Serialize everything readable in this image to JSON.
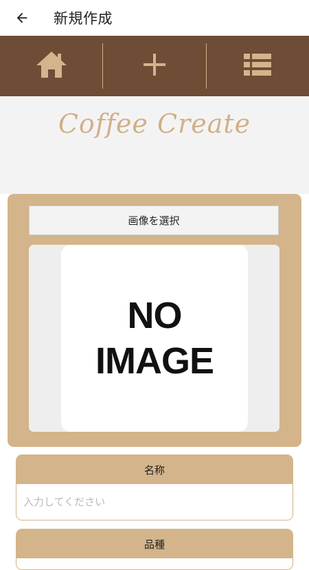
{
  "appbar": {
    "title": "新規作成"
  },
  "nav": {
    "items": [
      {
        "icon": "home-icon"
      },
      {
        "icon": "plus-icon"
      },
      {
        "icon": "list-icon"
      }
    ]
  },
  "brand": {
    "text": "Coffee Create"
  },
  "image_section": {
    "select_button_label": "画像を選択",
    "placeholder_line1": "NO",
    "placeholder_line2": "IMAGE"
  },
  "fields": {
    "name": {
      "label": "名称",
      "placeholder": "入力してください",
      "value": ""
    },
    "variety": {
      "label": "品種"
    }
  },
  "colors": {
    "nav_background": "#6e4c36",
    "accent_tan": "#d4b48a",
    "brand_text": "#d0b088"
  }
}
